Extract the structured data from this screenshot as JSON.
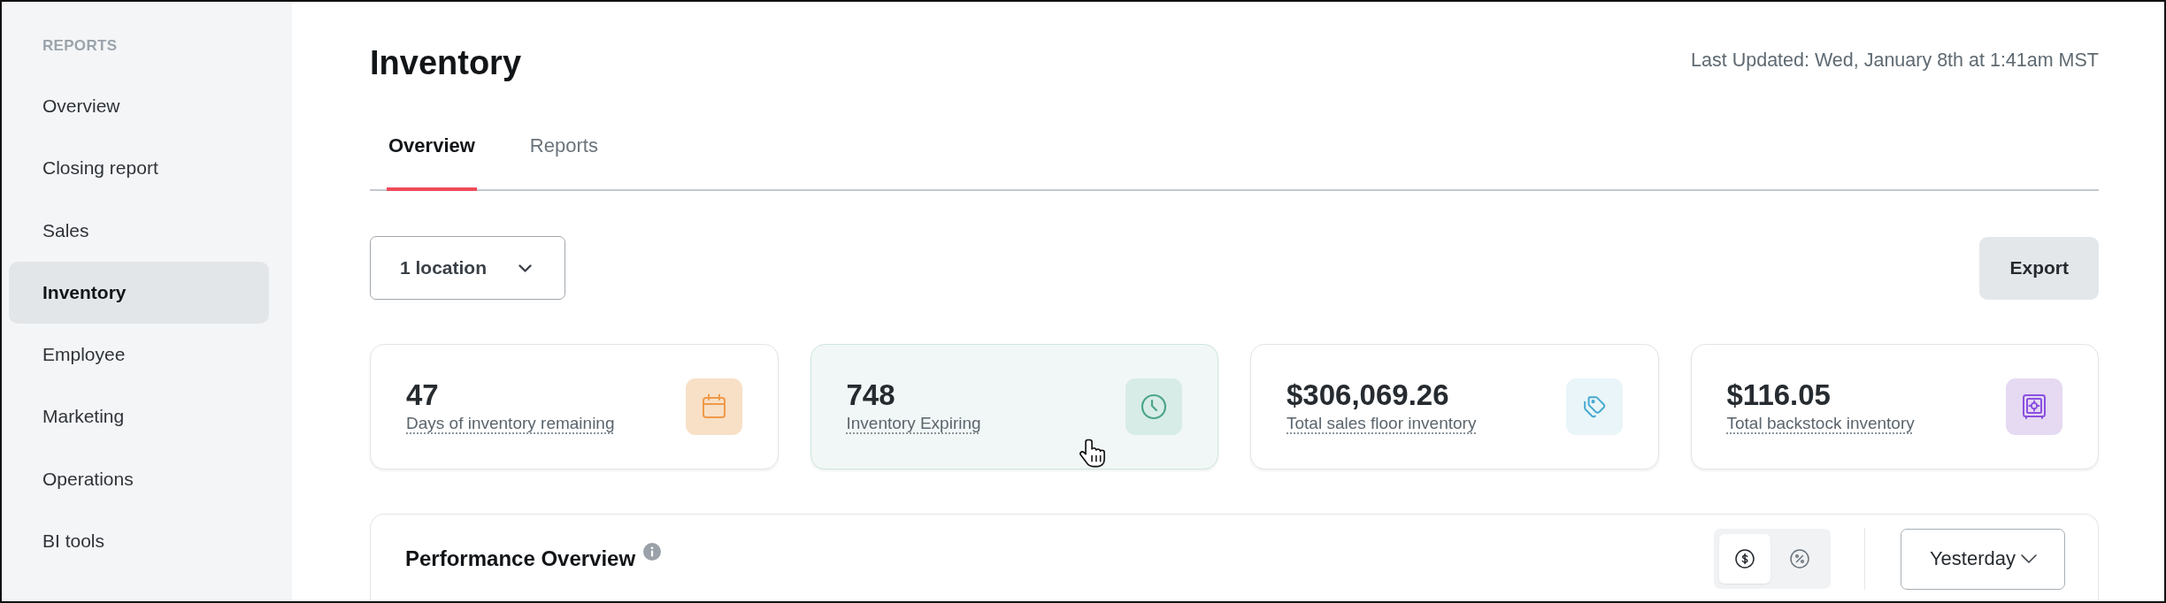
{
  "sidebar": {
    "heading": "REPORTS",
    "items": [
      {
        "label": "Overview",
        "selected": false
      },
      {
        "label": "Closing report",
        "selected": false
      },
      {
        "label": "Sales",
        "selected": false
      },
      {
        "label": "Inventory",
        "selected": true
      },
      {
        "label": "Employee",
        "selected": false
      },
      {
        "label": "Marketing",
        "selected": false
      },
      {
        "label": "Operations",
        "selected": false
      },
      {
        "label": "BI tools",
        "selected": false
      }
    ]
  },
  "header": {
    "title": "Inventory",
    "last_updated": "Last Updated: Wed, January 8th at 1:41am MST"
  },
  "tabs": [
    {
      "label": "Overview",
      "selected": true
    },
    {
      "label": "Reports",
      "selected": false
    }
  ],
  "toolbar": {
    "location_filter": "1 location",
    "export_button": "Export"
  },
  "metric_cards": [
    {
      "kind": "days",
      "value": "47",
      "label": "Days of inventory remaining",
      "highlighted": false
    },
    {
      "kind": "expiring",
      "value": "748",
      "label": "Inventory Expiring",
      "highlighted": true
    },
    {
      "kind": "sales_floor",
      "value": "$306,069.26",
      "label": "Total sales floor inventory",
      "highlighted": false
    },
    {
      "kind": "backstock",
      "value": "$116.05",
      "label": "Total backstock inventory",
      "highlighted": false
    }
  ],
  "performance": {
    "title": "Performance Overview",
    "view_toggle": [
      {
        "kind": "currency",
        "selected": true
      },
      {
        "kind": "percent",
        "selected": false
      }
    ],
    "period": "Yesterday"
  }
}
